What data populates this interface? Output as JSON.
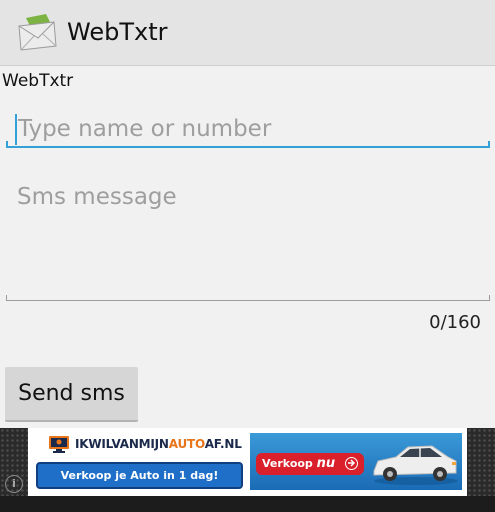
{
  "action_bar": {
    "title": "WebTxtr",
    "icon": "envelope-app-icon"
  },
  "form": {
    "label": "WebTxtr",
    "recipient": {
      "value": "",
      "placeholder": "Type name or number"
    },
    "message": {
      "value": "",
      "placeholder": "Sms message"
    },
    "counter": "0/160",
    "send_label": "Send sms"
  },
  "ad": {
    "brand_prefix": "IKWILVANMIJN",
    "brand_highlight": "AUTO",
    "brand_suffix": "AF.NL",
    "cta_left": "Verkoop je Auto in 1 dag!",
    "cta_right_prefix": "Verkoop",
    "cta_right_emphasis": "nu",
    "info_icon": "info-icon"
  },
  "colors": {
    "accent": "#33a0d8",
    "action_bar": "#e4e4e4",
    "background": "#f1f1f1",
    "button": "#d6d6d6"
  }
}
